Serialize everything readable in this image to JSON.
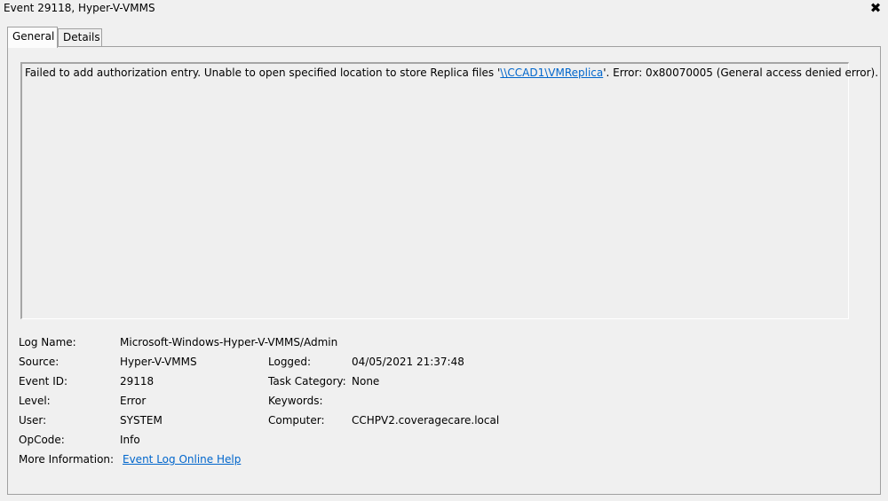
{
  "window": {
    "title": "Event 29118, Hyper-V-VMMS",
    "close_glyph": "✖"
  },
  "tabs": [
    {
      "label": "General",
      "active": true
    },
    {
      "label": "Details",
      "active": false
    }
  ],
  "description": {
    "prefix": "Failed to add authorization entry. Unable to open specified location to store Replica files '",
    "link": "\\\\CCAD1\\VMReplica",
    "suffix": "'. Error: 0x80070005 (General access denied error)."
  },
  "fields": {
    "log_name": {
      "label": "Log Name:",
      "value": "Microsoft-Windows-Hyper-V-VMMS/Admin"
    },
    "source": {
      "label": "Source:",
      "value": "Hyper-V-VMMS"
    },
    "logged": {
      "label": "Logged:",
      "value": "04/05/2021 21:37:48"
    },
    "event_id": {
      "label": "Event ID:",
      "value": "29118"
    },
    "task_category": {
      "label": "Task Category:",
      "value": "None"
    },
    "level": {
      "label": "Level:",
      "value": "Error"
    },
    "keywords": {
      "label": "Keywords:",
      "value": ""
    },
    "user": {
      "label": "User:",
      "value": "SYSTEM"
    },
    "computer": {
      "label": "Computer:",
      "value": "CCHPV2.coveragecare.local"
    },
    "opcode": {
      "label": "OpCode:",
      "value": "Info"
    },
    "more_info": {
      "label": "More Information:",
      "value": "Event Log Online Help"
    }
  },
  "colors": {
    "link": "#0066cc",
    "background": "#f0f0f0",
    "border": "#a0a0a0"
  }
}
